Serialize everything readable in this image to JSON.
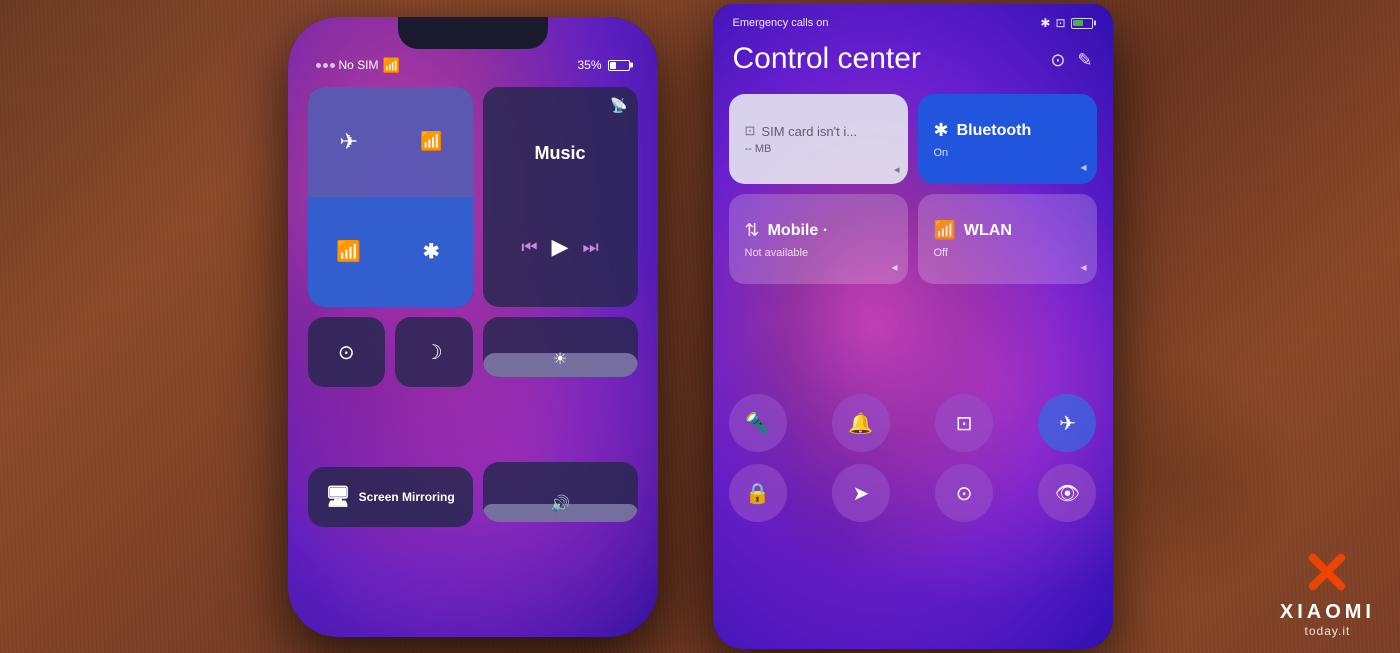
{
  "background": {
    "color": "#6b3a22"
  },
  "iphone": {
    "status": {
      "signal_dots": 3,
      "carrier": "No SIM",
      "battery_percent": "35%"
    },
    "control_center": {
      "airplane_icon": "✈",
      "cellular_icon": "((·))",
      "wifi_icon": "WiFi",
      "bluetooth_icon": "ɮ",
      "music_label": "Music",
      "rotation_icon": "⟳",
      "moon_icon": "☽",
      "screen_mirror_label": "Screen Mirroring",
      "brightness_icon": "☀",
      "volume_icon": "◁)"
    }
  },
  "xiaomi": {
    "status": {
      "emergency": "Emergency calls on",
      "bluetooth_icon": "✱",
      "sim_icon": "⊡",
      "battery_level": "60"
    },
    "header": {
      "title": "Control center",
      "settings_icon": "⊙",
      "edit_icon": "✎"
    },
    "tiles": {
      "sim": {
        "title": "SIM card isn't i...",
        "subtitle": "-- MB",
        "arrow": "◂"
      },
      "bluetooth": {
        "title": "Bluetooth",
        "subtitle": "On",
        "icon": "✱"
      },
      "mobile_data": {
        "title": "Mobile ·",
        "subtitle": "Not available",
        "icon": "⇅"
      },
      "wlan": {
        "title": "WLAN",
        "subtitle": "Off",
        "icon": "WiFi"
      }
    },
    "bottom_icons": {
      "row1": [
        "🔦",
        "🔔",
        "⊡",
        "✈"
      ],
      "row2": [
        "🔒",
        "➤",
        "⊙",
        "👁"
      ]
    }
  },
  "brand": {
    "name": "xiaomi",
    "domain": "today.it"
  }
}
